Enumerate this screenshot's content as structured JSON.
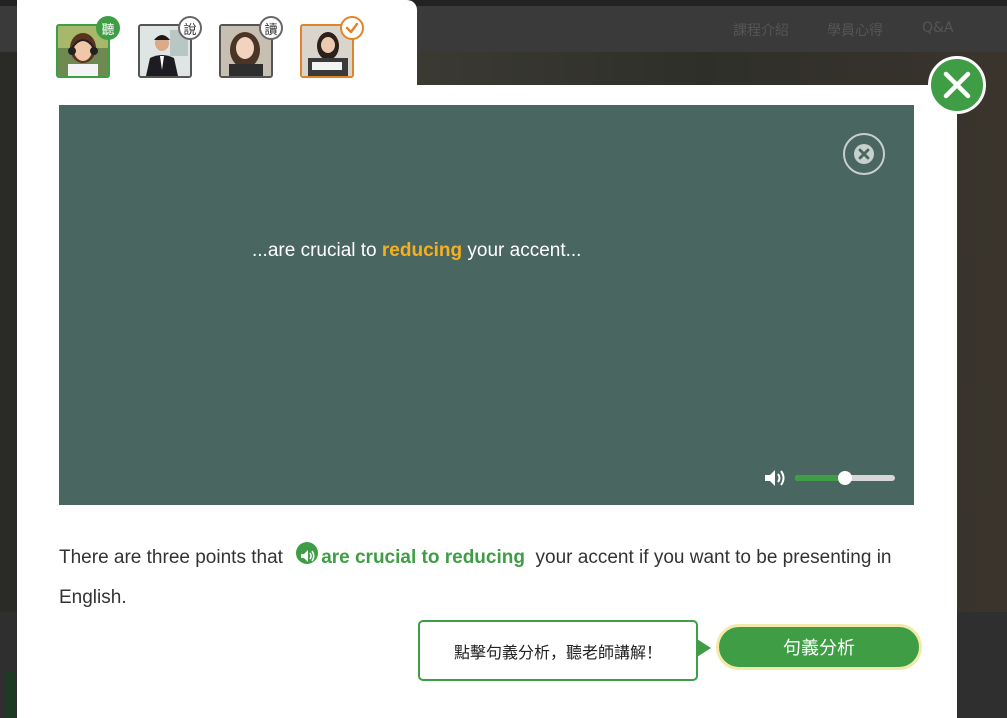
{
  "background_nav": {
    "items": [
      "課程介紹",
      "學員心得",
      "Q&A"
    ]
  },
  "tabs": [
    {
      "name": "listen",
      "badge": "聽",
      "state": "active"
    },
    {
      "name": "speak",
      "badge": "說",
      "state": "normal"
    },
    {
      "name": "read",
      "badge": "讀",
      "state": "normal"
    },
    {
      "name": "complete",
      "badge": "",
      "state": "done"
    }
  ],
  "player": {
    "subtitle_before": "...are crucial to ",
    "subtitle_highlight": "reducing",
    "subtitle_after": " your accent...",
    "volume_level": 0.5
  },
  "sentence": {
    "before": "There are three points that ",
    "phrase": "are crucial to reducing",
    "after": "  your accent if you want to be presenting in English."
  },
  "tooltip": {
    "text": "點擊句義分析，聽老師講解！"
  },
  "analysis_button": {
    "label": "句義分析"
  },
  "colors": {
    "accent_green": "#3f9e45",
    "highlight_yellow": "#f5b020",
    "done_orange": "#e0842a",
    "player_bg": "#4a6660"
  }
}
